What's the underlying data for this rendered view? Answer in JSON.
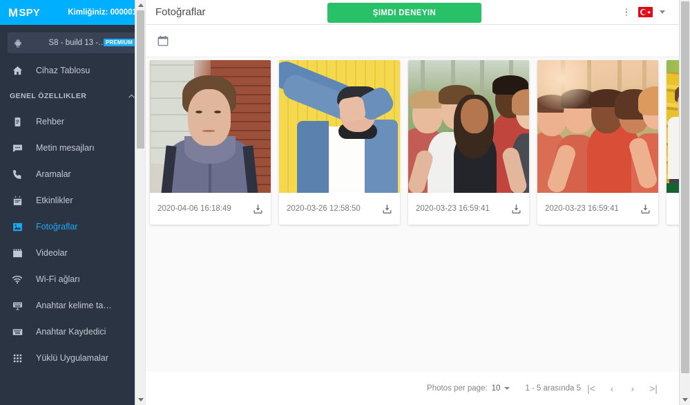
{
  "sidebar": {
    "brand": "mSPY",
    "brand_m": "M",
    "brand_rest": "SPY",
    "account_id_label": "Kimliğiniz: 000001",
    "device": {
      "label": "S8 - build 13 -…",
      "badge": "PREMIUM",
      "icon": "android-icon"
    },
    "dashboard_item": {
      "label": "Cihaz Tablosu",
      "icon": "home-icon"
    },
    "section": {
      "label": "GENEL ÖZELLIKLER",
      "chevron": "chevron-up-icon"
    },
    "items": [
      {
        "label": "Rehber",
        "icon": "contacts-icon",
        "active": false
      },
      {
        "label": "Metin mesajları",
        "icon": "message-icon",
        "active": false
      },
      {
        "label": "Aramalar",
        "icon": "phone-icon",
        "active": false
      },
      {
        "label": "Etkinlikler",
        "icon": "calendar-icon",
        "active": false
      },
      {
        "label": "Fotoğraflar",
        "icon": "photo-icon",
        "active": true
      },
      {
        "label": "Videolar",
        "icon": "video-icon",
        "active": false
      },
      {
        "label": "Wi-Fi ağları",
        "icon": "wifi-icon",
        "active": false
      },
      {
        "label": "Anahtar kelime ta…",
        "icon": "keyword-alert-icon",
        "active": false
      },
      {
        "label": "Anahtar Kaydedici",
        "icon": "keylogger-icon",
        "active": false
      },
      {
        "label": "Yüklü Uygulamalar",
        "icon": "apps-grid-icon",
        "active": false
      }
    ]
  },
  "header": {
    "title": "Fotoğraflar",
    "cta_label": "ŞIMDI DENEYIN",
    "kebab_icon": "more-vertical-icon",
    "flag_icon": "turkey-flag-icon",
    "flag_caret_icon": "chevron-down-icon"
  },
  "toolbar": {
    "calendar_icon": "calendar-filter-icon"
  },
  "photos": [
    {
      "timestamp": "2020-04-06 16:18:49",
      "download_icon": "download-icon",
      "art": "p1",
      "alt": "young-man-brick-wall"
    },
    {
      "timestamp": "2020-03-26 12:58:50",
      "download_icon": "download-icon",
      "art": "p2",
      "alt": "teen-denim-jacket-yellow-wall"
    },
    {
      "timestamp": "2020-03-23 16:59:41",
      "download_icon": "download-icon",
      "art": "p3",
      "alt": "group-selfie-park"
    },
    {
      "timestamp": "2020-03-23 16:59:41",
      "download_icon": "download-icon",
      "art": "p4",
      "alt": "group-selfie-sunset"
    },
    {
      "timestamp": "",
      "download_icon": "download-icon",
      "art": "p5",
      "alt": "couple-yellow-bleachers"
    }
  ],
  "footer": {
    "per_page_label": "Photos per page:",
    "per_page_value": "10",
    "range_label": "1 - 5 arasında 5",
    "first_page": "|<",
    "prev_page": "‹",
    "next_page": "›",
    "last_page": ">|"
  },
  "colors": {
    "brand_blue": "#00b0ff",
    "accent_blue": "#1ba9f5",
    "sidebar_bg": "#2b3443",
    "cta_green": "#28c168",
    "flag_red": "#e30a17"
  }
}
